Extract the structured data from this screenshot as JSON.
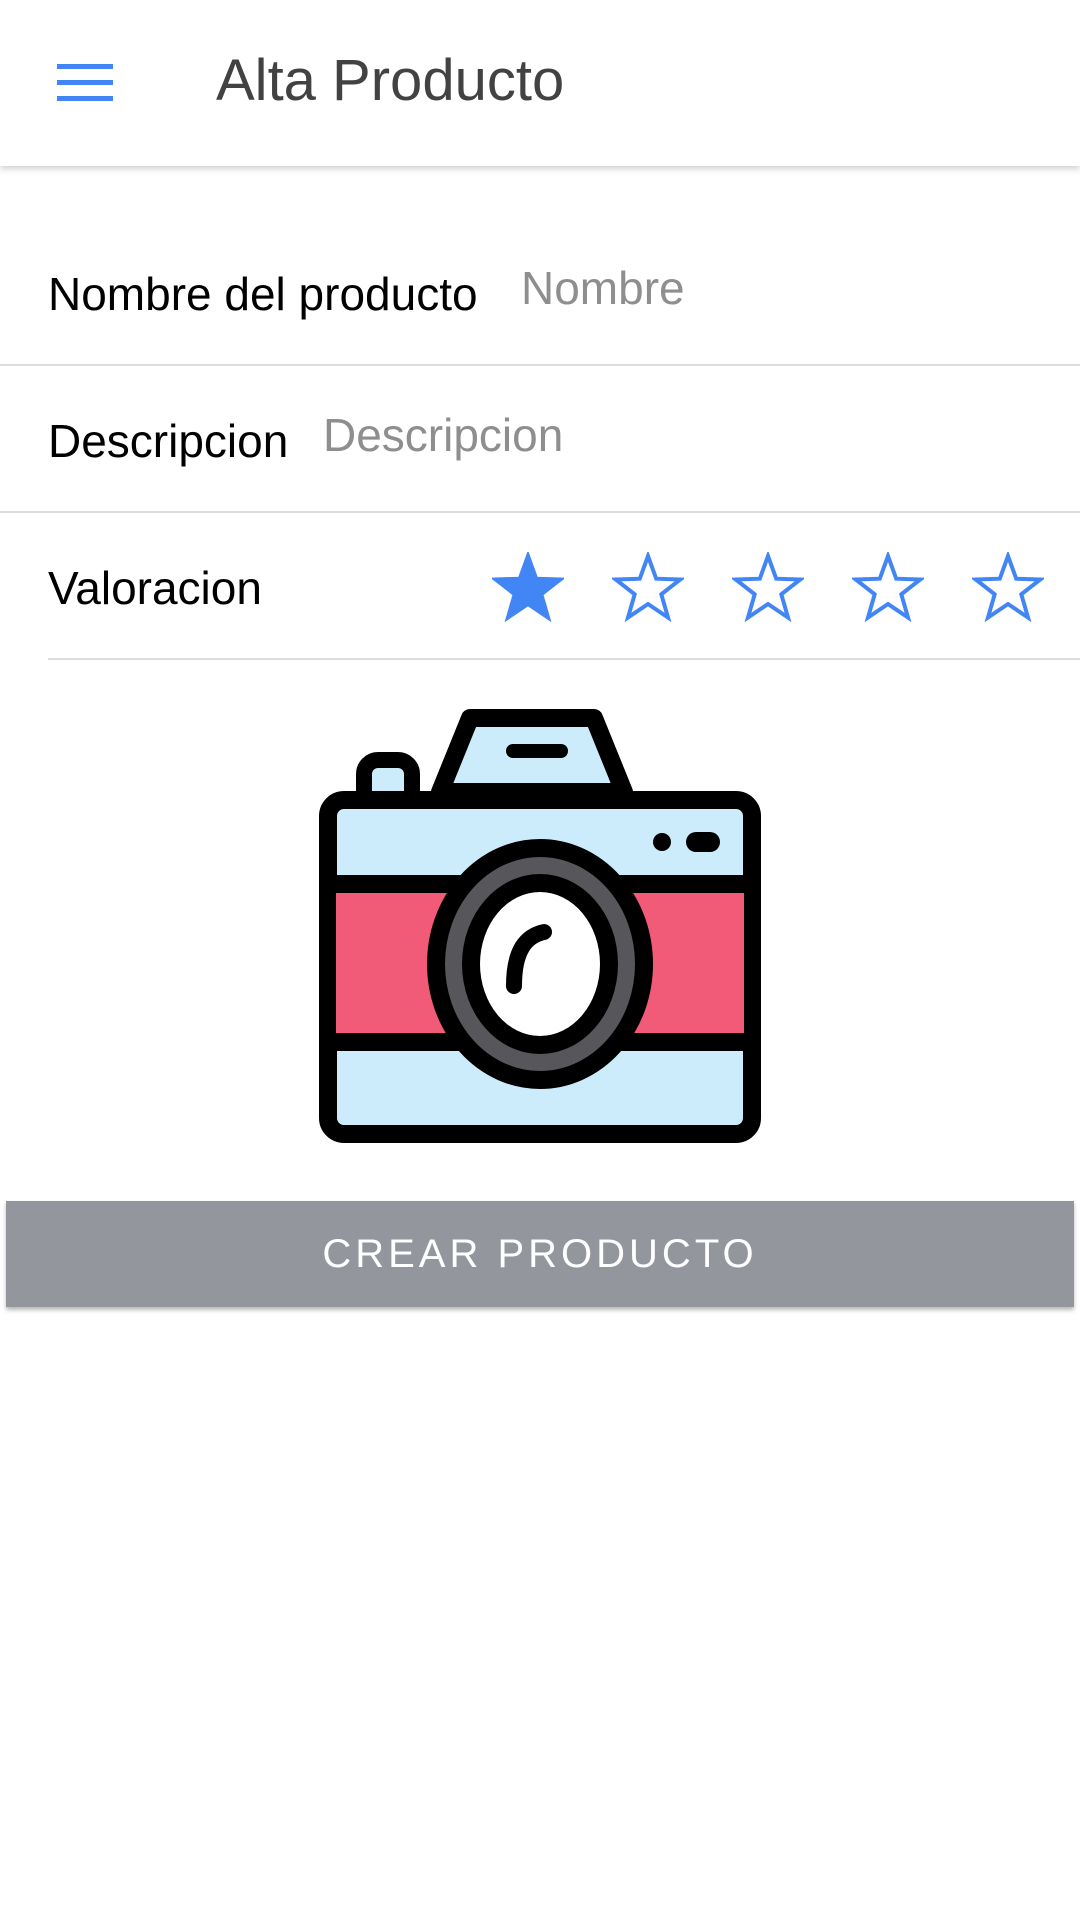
{
  "appbar": {
    "title": "Alta Producto",
    "menu_icon": "menu-icon"
  },
  "form": {
    "nombre": {
      "label": "Nombre del producto",
      "placeholder": "Nombre",
      "value": ""
    },
    "descripcion": {
      "label": "Descripcion",
      "placeholder": "Descripcion",
      "value": ""
    },
    "valoracion": {
      "label": "Valoracion",
      "rating": 1,
      "max": 5
    }
  },
  "image_picker": {
    "icon": "camera-icon"
  },
  "actions": {
    "create_label": "CREAR PRODUCTO"
  },
  "colors": {
    "accent": "#4285f4",
    "button_bg": "#93969d",
    "title_text": "#424242",
    "placeholder": "#8e8e8e",
    "divider": "#dcdcdc"
  }
}
